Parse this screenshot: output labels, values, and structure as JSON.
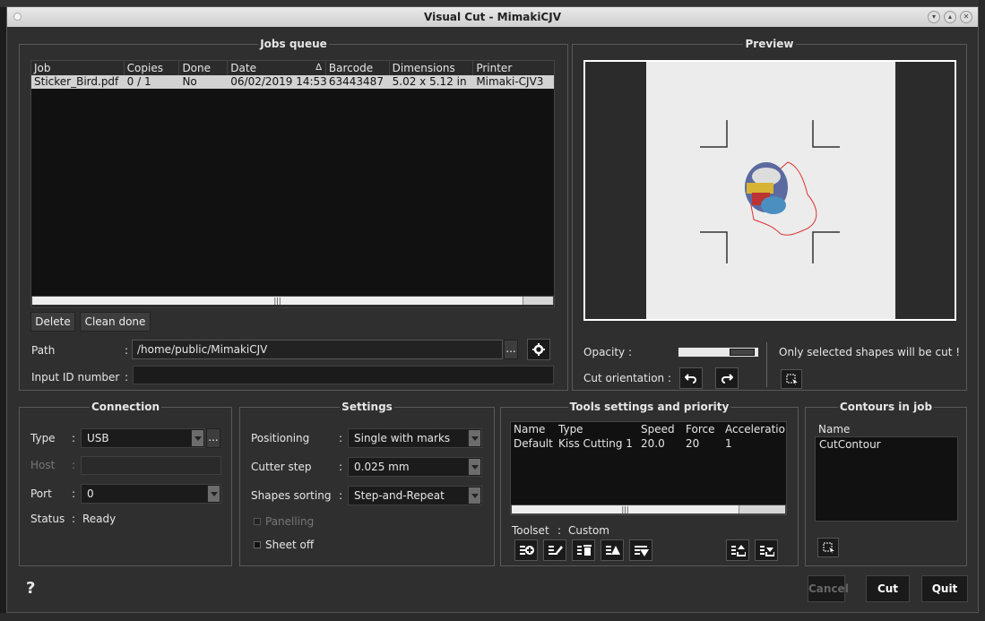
{
  "window": {
    "title": "Visual Cut - MimakiCJV"
  },
  "jobs_queue": {
    "title": "Jobs queue",
    "columns": [
      "Job",
      "Copies",
      "Done",
      "Date",
      "Barcode",
      "Dimensions",
      "Printer"
    ],
    "sort_indicator": "∆",
    "rows": [
      {
        "job": "Sticker_Bird.pdf",
        "copies": "0 / 1",
        "done": "No",
        "date": "06/02/2019 14:53",
        "barcode": "63443487",
        "dimensions": "5.02 x 5.12 in",
        "printer": "Mimaki-CJV3"
      }
    ],
    "delete_label": "Delete",
    "clean_done_label": "Clean done",
    "path_label": "Path",
    "path_value": "/home/public/MimakiCJV",
    "browse_label": "...",
    "input_id_label": "Input ID number",
    "input_id_value": ""
  },
  "preview": {
    "title": "Preview",
    "opacity_label": "Opacity :",
    "cut_orientation_label": "Cut orientation :",
    "note": "Only selected shapes will be cut !"
  },
  "connection": {
    "title": "Connection",
    "type_label": "Type",
    "type_value": "USB",
    "host_label": "Host",
    "host_value": "",
    "port_label": "Port",
    "port_value": "0",
    "status_label": "Status",
    "status_value": "Ready",
    "browse_label": "..."
  },
  "settings": {
    "title": "Settings",
    "positioning_label": "Positioning",
    "positioning_value": "Single with marks",
    "cutter_step_label": "Cutter step",
    "cutter_step_value": "0.025 mm",
    "shapes_sorting_label": "Shapes sorting",
    "shapes_sorting_value": "Step-and-Repeat",
    "panelling_label": "Panelling",
    "sheet_off_label": "Sheet off"
  },
  "tools": {
    "title": "Tools settings and priority",
    "columns": [
      "Name",
      "Type",
      "Speed",
      "Force",
      "Acceleratio"
    ],
    "rows": [
      {
        "name": "Default",
        "type": "Kiss Cutting 1",
        "speed": "20.0",
        "force": "20",
        "accel": "1"
      }
    ],
    "toolset_label": "Toolset",
    "toolset_value": "Custom"
  },
  "contours": {
    "title": "Contours in job",
    "column": "Name",
    "items": [
      "CutContour"
    ]
  },
  "footer": {
    "help": "?",
    "cancel_label": "Cancel",
    "cut_label": "Cut",
    "quit_label": "Quit"
  }
}
